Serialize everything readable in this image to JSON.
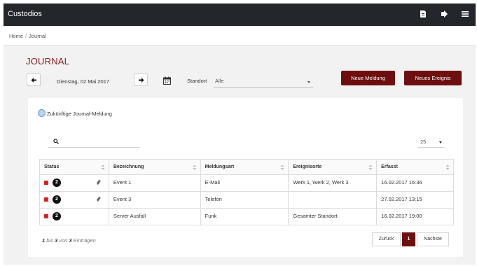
{
  "app": {
    "title": "Custodios"
  },
  "breadcrumb": {
    "home": "Home",
    "separator": "/",
    "current": "Journal"
  },
  "page": {
    "title": "JOURNAL"
  },
  "toolbar": {
    "date": "Dienstag, 02 Mai 2017",
    "standort_label": "Standort",
    "standort_value": "Alle",
    "new_report_label": "Neue Meldung",
    "new_event_label": "Neues Ereignis"
  },
  "filter": {
    "future_label": "Zukünftige Journal-Meldung"
  },
  "search": {
    "placeholder": ""
  },
  "page_length": {
    "value": "25"
  },
  "table": {
    "headers": [
      "Status",
      "Bezeichnung",
      "Meldungsart",
      "Ereignisorte",
      "Erfasst"
    ],
    "rows": [
      {
        "status_count": "2",
        "attachment": true,
        "bezeichnung": "Event 1",
        "meldungsart": "E-Mail",
        "ereignisorte": "Werk 1, Werk 2, Werk 3",
        "erfasst": "16.02.2017 16:36"
      },
      {
        "status_count": "2",
        "attachment": true,
        "bezeichnung": "Event 3",
        "meldungsart": "Telefon",
        "ereignisorte": "",
        "erfasst": "27.02.2017 13:15"
      },
      {
        "status_count": "2",
        "attachment": false,
        "bezeichnung": "Server Ausfall",
        "meldungsart": "Funk",
        "ereignisorte": "Gesamter Standort",
        "erfasst": "16.02.2017 19:00"
      }
    ]
  },
  "footer": {
    "info": {
      "from": "1",
      "bis": "bis",
      "to": "3",
      "von": "von",
      "total": "3",
      "suffix": "Einträgen"
    },
    "pagination": {
      "prev": "Zurück",
      "current": "1",
      "next": "Nächste"
    }
  },
  "colors": {
    "topbar": "#23262b",
    "accent": "#6d0f0f",
    "title": "#8b1b1b",
    "status": "#d42323"
  },
  "icons": {
    "topbar": [
      "document-icon",
      "logout-icon",
      "menu-icon"
    ],
    "toolbar": [
      "arrow-left-icon",
      "arrow-right-icon",
      "calendar-icon",
      "chevron-down-icon"
    ],
    "table": [
      "sort-icon",
      "paperclip-icon"
    ]
  }
}
